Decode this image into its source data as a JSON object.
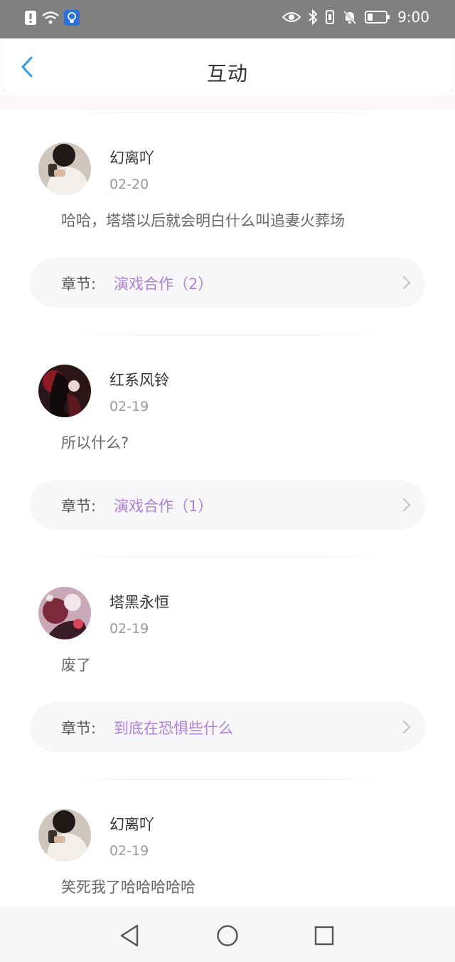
{
  "status_bar": {
    "time": "9:00",
    "left_icons": [
      "alert-icon",
      "wifi-icon",
      "lightbulb-notification-icon"
    ],
    "right_icons": [
      "eye-icon",
      "bluetooth-icon",
      "vibrate-icon",
      "mute-bell-icon",
      "battery-icon"
    ],
    "battery_level": 0.3
  },
  "header": {
    "title": "互动",
    "back_icon": "chevron-left-icon",
    "accent_color": "#2b9de6"
  },
  "chapter_prefix": "章节:",
  "chapter_color": "#b07fd8",
  "interactions": [
    {
      "user": "幻离吖",
      "date": "02-20",
      "comment": "哈哈，塔塔以后就会明白什么叫追妻火葬场",
      "chapter": "演戏合作（2）"
    },
    {
      "user": "红系风铃",
      "date": "02-19",
      "comment": "所以什么?",
      "chapter": "演戏合作（1）"
    },
    {
      "user": "塔黑永恒",
      "date": "02-19",
      "comment": "废了",
      "chapter": "到底在恐惧些什么"
    },
    {
      "user": "幻离吖",
      "date": "02-19",
      "comment": "笑死我了哈哈哈哈哈",
      "chapter": ""
    }
  ],
  "nav_keys": [
    "back-triangle-icon",
    "home-circle-icon",
    "recents-square-icon"
  ]
}
